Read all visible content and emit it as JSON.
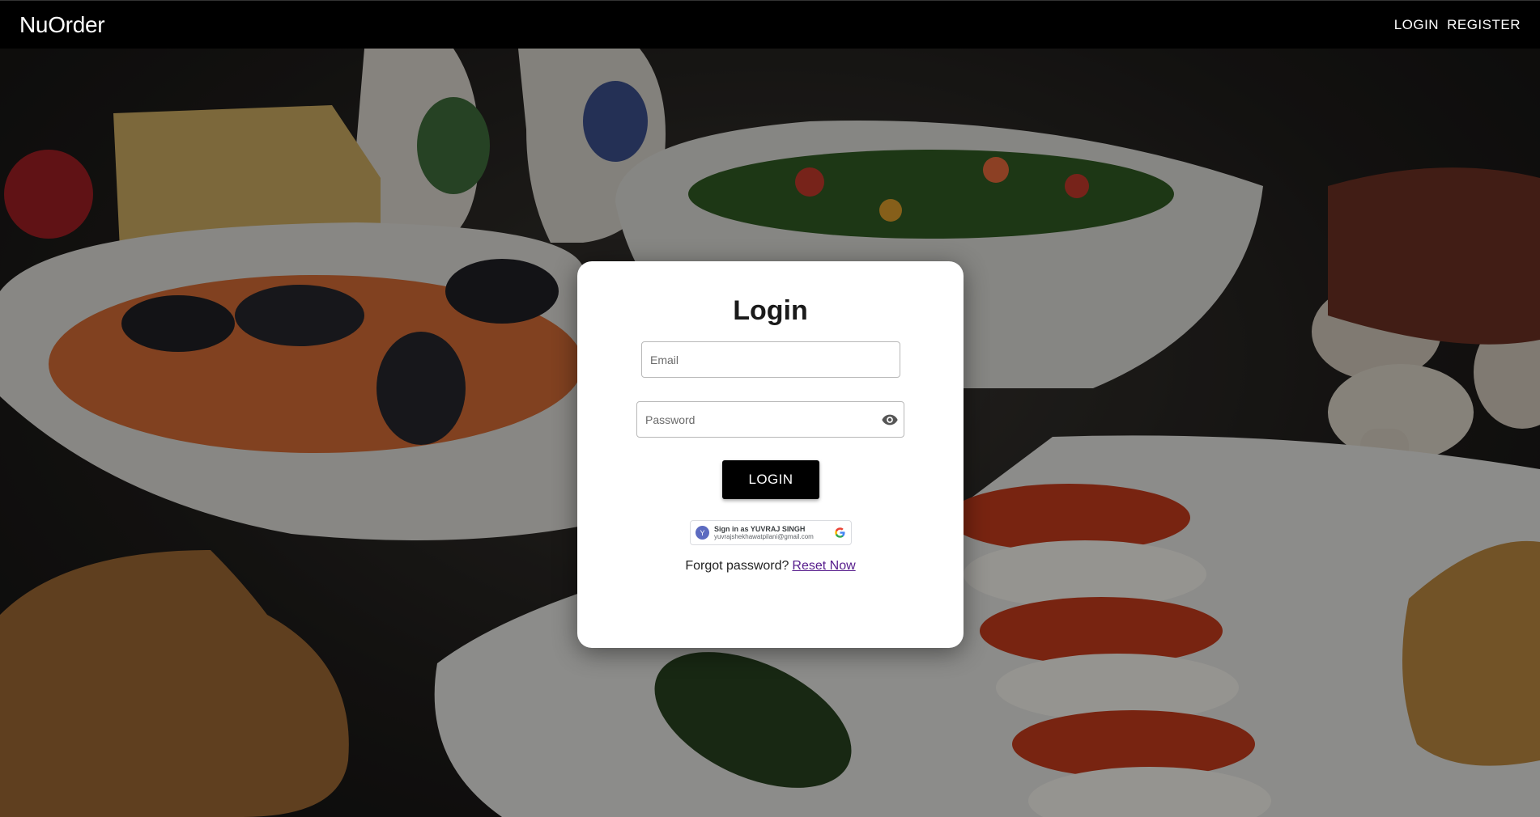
{
  "appbar": {
    "brand": "NuOrder",
    "nav": [
      {
        "label": "LOGIN"
      },
      {
        "label": "REGISTER"
      }
    ]
  },
  "login_card": {
    "title": "Login",
    "email": {
      "placeholder": "Email",
      "value": ""
    },
    "password": {
      "placeholder": "Password",
      "value": "",
      "toggle_icon": "eye-icon"
    },
    "submit_label": "LOGIN",
    "google_signin": {
      "avatar_initial": "Y",
      "label": "Sign in as YUVRAJ SINGH",
      "email": "yuvrajshekhawatpilani@gmail.com",
      "icon": "google-icon"
    },
    "forgot": {
      "prompt": "Forgot password?",
      "link_label": "Reset Now"
    }
  },
  "background": {
    "description_icon": "food-background-image"
  },
  "colors": {
    "appbar_bg": "#000000",
    "button_bg": "#000000",
    "link": "#551a8b",
    "card_bg": "#ffffff"
  }
}
